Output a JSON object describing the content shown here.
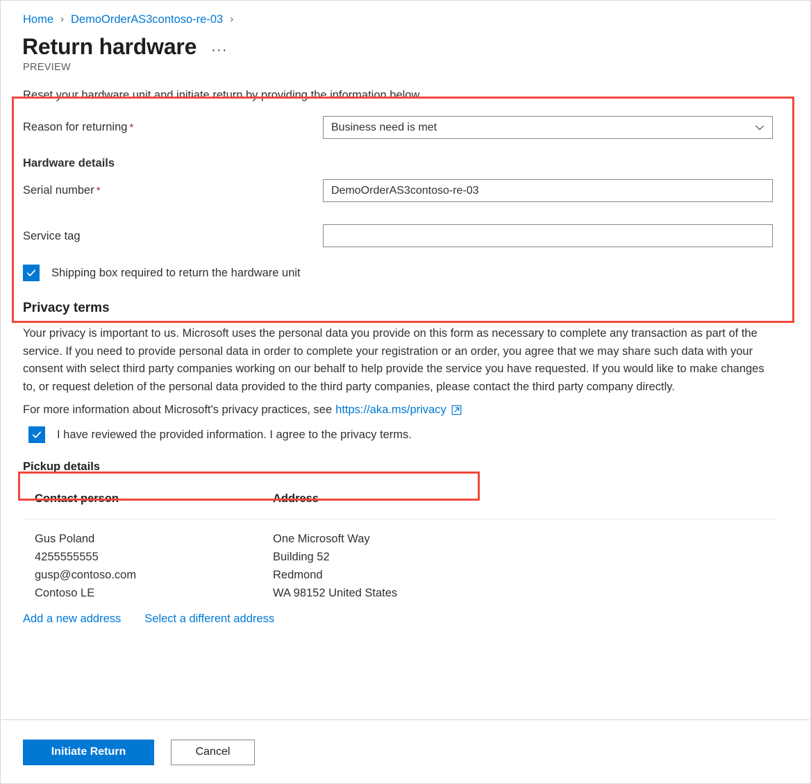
{
  "breadcrumb": {
    "items": [
      "Home",
      "DemoOrderAS3contoso-re-03"
    ],
    "separator": "›"
  },
  "header": {
    "title": "Return hardware",
    "more_menu": "···",
    "preview_tag": "PREVIEW"
  },
  "form": {
    "intro": "Reset your hardware unit and initiate return by providing the information below.",
    "reason_label": "Reason for returning",
    "reason_required": "*",
    "reason_value": "Business need is met",
    "hardware_details_heading": "Hardware details",
    "serial_label": "Serial number",
    "serial_required": "*",
    "serial_value": "DemoOrderAS3contoso-re-03",
    "service_tag_label": "Service tag",
    "service_tag_value": "",
    "service_tag_placeholder": "",
    "shipping_box_label": "Shipping box required to return the hardware unit",
    "shipping_box_checked": true
  },
  "privacy": {
    "heading": "Privacy terms",
    "paragraph": "Your privacy is important to us. Microsoft uses the personal data you provide on this form as necessary to complete any transaction as part of the service. If you need to provide personal data in order to complete your registration or an order, you agree that we may share such data with your consent with select third party companies working on our behalf to help provide the service you have requested. If you would like to make changes to, or request deletion of the personal data provided to the third party companies, please contact the third party company directly.",
    "more_info_text": "For more information about Microsoft's privacy practices, see",
    "link_text": "https://aka.ms/privacy",
    "agree_label": "I have reviewed the provided information. I agree to the privacy terms.",
    "agree_checked": true
  },
  "pickup": {
    "heading": "Pickup details",
    "columns": [
      "Contact person",
      "Address"
    ],
    "rows": [
      {
        "contact": [
          "Gus Poland",
          "4255555555",
          "gusp@contoso.com",
          "Contoso LE"
        ],
        "address": [
          "One Microsoft Way",
          "Building 52",
          "Redmond",
          "WA 98152 United States"
        ]
      }
    ],
    "add_address_link": "Add a new address",
    "select_address_link": "Select a different address"
  },
  "footer": {
    "primary_button": "Initiate Return",
    "secondary_button": "Cancel"
  },
  "colors": {
    "accent": "#0078d4",
    "required": "#a4262c",
    "annotation": "#f2483c",
    "text": "#323130"
  }
}
